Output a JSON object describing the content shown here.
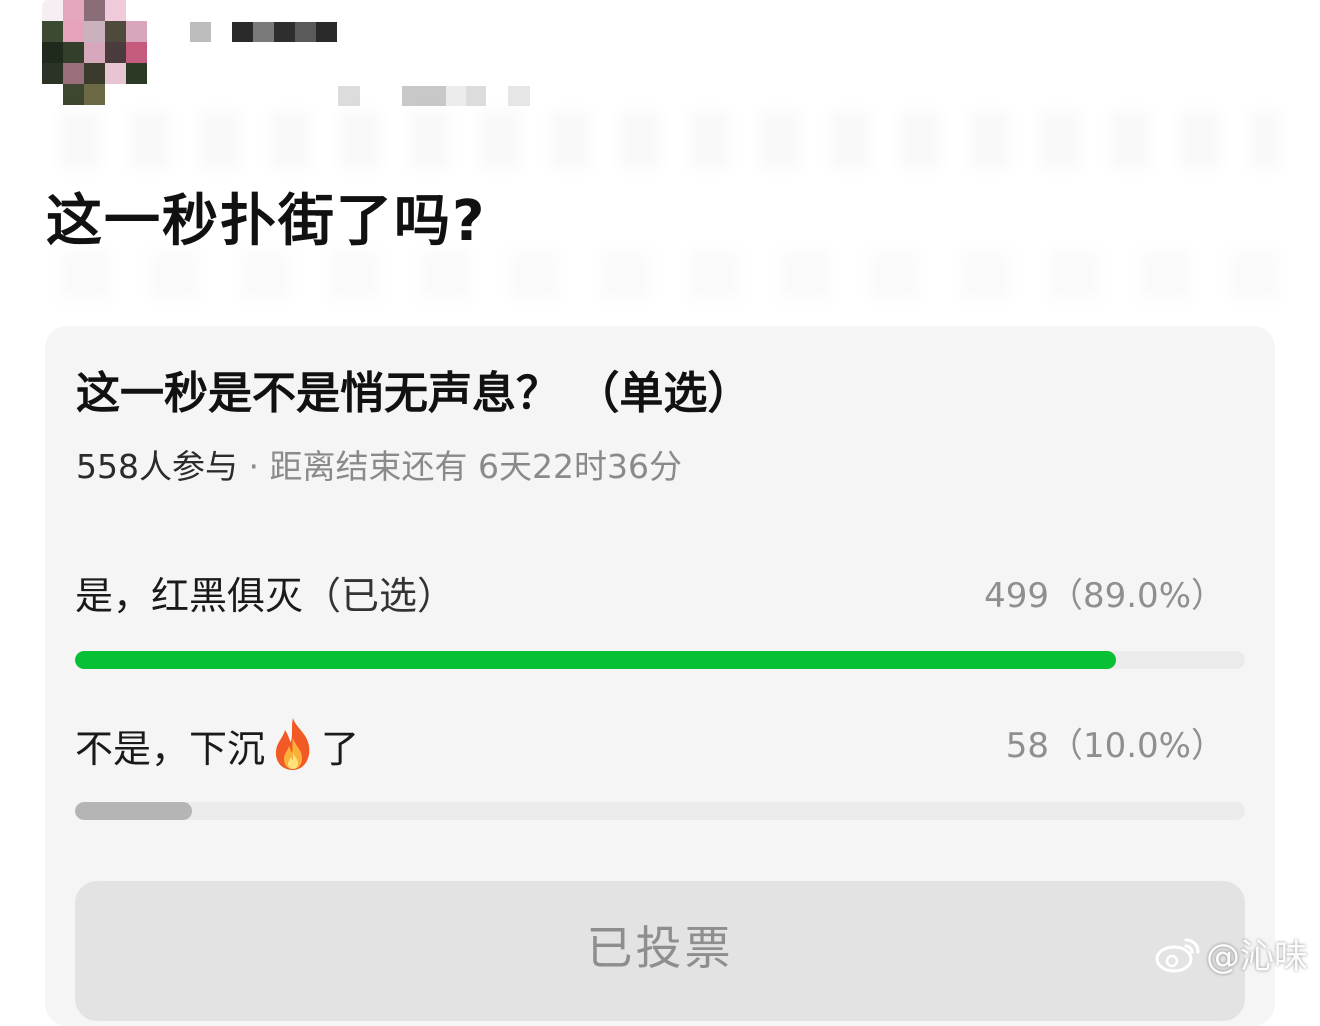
{
  "header": {
    "avatar_colors": [
      "#f6eef2",
      "#e5a6c0",
      "#8a6d76",
      "#f0c9da",
      "#ffffff",
      "#ffffff",
      "#3d4a33",
      "#e4a2bd",
      "#c9b2bd",
      "#4e4a3c",
      "#d9a5bd",
      "#ffffff",
      "#1f2a1d",
      "#343f2b",
      "#d7a8bb",
      "#4a3c3c",
      "#c55c7e",
      "#ffffff",
      "#2a3325",
      "#9a6f7a",
      "#3a3a2d",
      "#e9c5d3",
      "#2b3a25",
      "#ffffff",
      "#ffffff",
      "#3d4630",
      "#6b6a45",
      "#ffffff",
      "#ffffff",
      "#ffffff"
    ],
    "username_pixel_colors": [
      "#bdbdbd",
      "#ffffff",
      "#2a2a2a",
      "#7a7a7a",
      "#2e2e2e",
      "#5a5a5a",
      "#2a2a2a"
    ],
    "meta_pixel_colors": [
      "#dcdcdc",
      "#ffffff",
      "#ffffff",
      "#c8c8c8",
      "#c8c8c8",
      "#ececec",
      "#dcdcdc",
      "#ffffff",
      "#e6e6e6"
    ]
  },
  "post": {
    "title": "这一秒扑街了吗?"
  },
  "poll": {
    "question": "这一秒是不是悄无声息？ （单选）",
    "participants": "558人参与",
    "separator": " · ",
    "deadline": "距离结束还有 6天22时36分",
    "options": [
      {
        "label": "是，红黑俱灭",
        "selected_tag": "（已选）",
        "result": "499（89.0%）",
        "fraction": 0.89,
        "bar_color": "#07c033"
      },
      {
        "label_before": "不是，下沉",
        "icon": "fire-icon",
        "label_after": "了",
        "result": "58（10.0%）",
        "fraction": 0.1,
        "bar_color": "#b5b5b5"
      }
    ],
    "button_label": "已投票"
  },
  "watermark": {
    "text": "@沁味",
    "icon": "weibo-icon"
  }
}
